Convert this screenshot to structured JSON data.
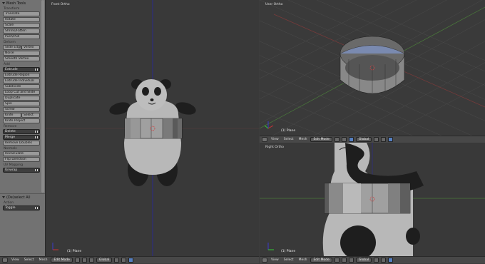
{
  "toolshelf": {
    "title": "Mesh Tools",
    "transform": {
      "heading": "Transform",
      "items": [
        "Translate",
        "Rotate",
        "Scale",
        "Shrink/Fatten",
        "Push/Pull"
      ]
    },
    "deform": {
      "heading": "Deform",
      "slide_edge": "Slide Edge",
      "vertex": "Vertex",
      "items": [
        "Noise",
        "Smooth Vertex"
      ]
    },
    "add": {
      "heading": "Add",
      "extrude": "Extrude",
      "items": [
        "Extrude Region",
        "Extrude Individual",
        "Subdivide",
        "Loop Cut and Slide",
        "Duplicate",
        "Spin",
        "Screw"
      ],
      "knife": "Knife",
      "select": "Select",
      "knife_project": "Knife Project"
    },
    "remove": {
      "heading": "Remove",
      "delete": "Delete",
      "merge": "Merge",
      "remove_doubles": "Remove Doubles"
    },
    "normals": {
      "heading": "Normals",
      "items": [
        "Recalculate",
        "Flip Direction"
      ]
    },
    "uv": {
      "heading": "UV Mapping",
      "unwrap": "Unwrap"
    }
  },
  "operator": {
    "title": "(De)select All",
    "action_label": "Action",
    "action_value": "Toggle"
  },
  "viewports": {
    "front": {
      "label": "Front Ortho",
      "object": "(1) Plane"
    },
    "user": {
      "label": "User Ortho",
      "object": "(1) Plane"
    },
    "right": {
      "label": "Right Ortho",
      "object": "(1) Plane"
    }
  },
  "header": {
    "view": "View",
    "select": "Select",
    "mesh": "Mesh",
    "mode": "Edit Mode",
    "orientation": "Global"
  },
  "colors": {
    "grid_x_axis": "#8c3a3a",
    "grid_y_axis": "#5b8a3a",
    "z_axis": "#2c2c8c",
    "selected_face": "#a0a0a0",
    "panda_black": "#1e1e1e",
    "panda_white": "#b8b8b8"
  }
}
